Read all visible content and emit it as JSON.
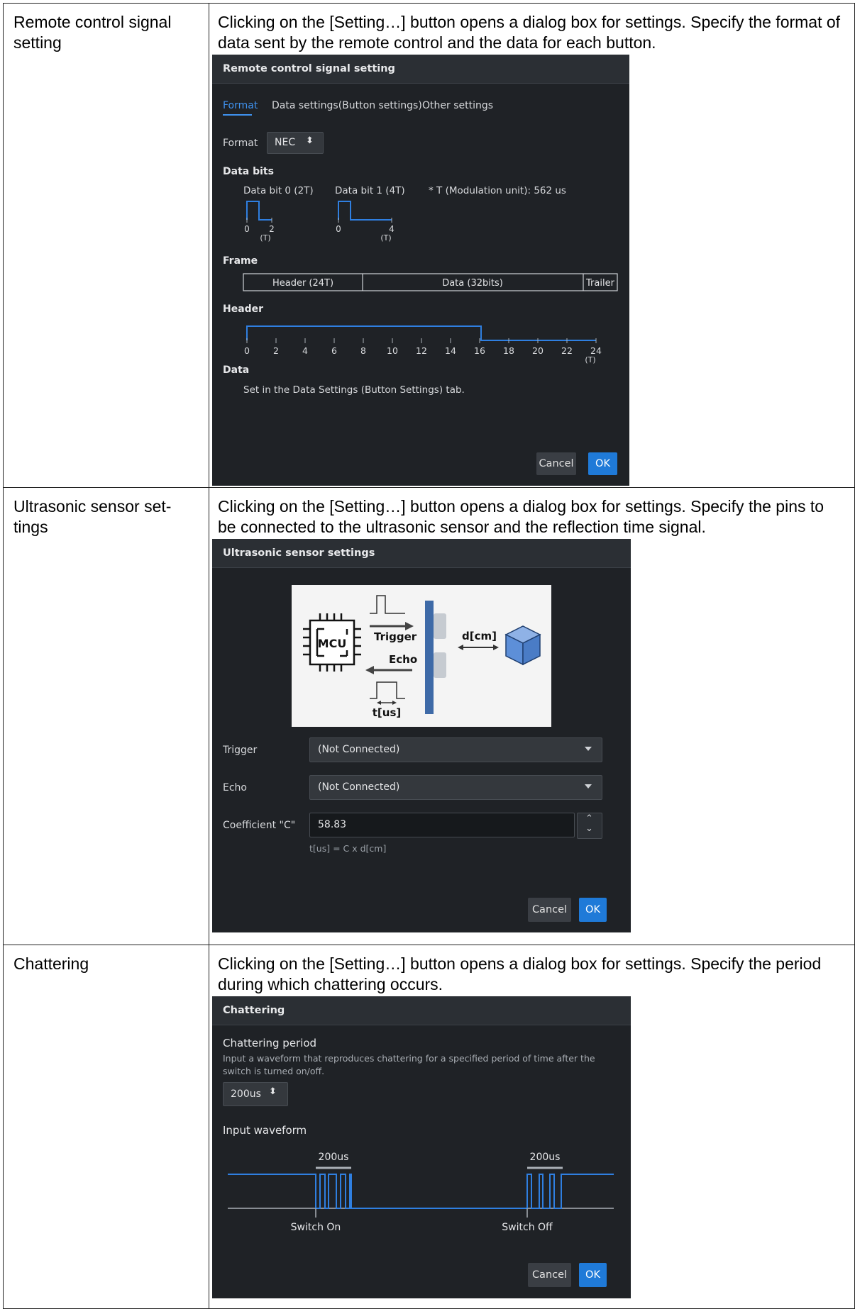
{
  "rows": [
    {
      "label": "Remote control signal setting",
      "desc": "Clicking on the [Setting…] button opens a dialog box for settings. Specify the format of data sent by the remote control and the data for each button."
    },
    {
      "label": "Ultrasonic sensor set-tings",
      "desc": "Clicking on the [Setting…] button opens a dialog box for settings. Specify the pins to be connected to the ultrasonic sensor and the reflection time signal."
    },
    {
      "label": "Chattering",
      "desc": "Clicking on the [Setting…] button opens a dialog box for settings. Specify the period during which chattering occurs."
    }
  ],
  "remote_dialog": {
    "title": "Remote control signal setting",
    "tabs": [
      "Format",
      "Data settings(Button settings)",
      "Other settings"
    ],
    "format_label": "Format",
    "format_value": "NEC",
    "data_bits_heading": "Data bits",
    "bit0_label": "Data bit 0 (2T)",
    "bit1_label": "Data bit 1 (4T)",
    "modulation_note": "* T (Modulation unit): 562 us",
    "bit0_ticks": [
      "0",
      "2",
      "(T)"
    ],
    "bit1_ticks": [
      "0",
      "4",
      "(T)"
    ],
    "frame_heading": "Frame",
    "frame_cells": [
      "Header (24T)",
      "Data (32bits)",
      "Trailer"
    ],
    "header_heading": "Header",
    "header_ticks": [
      "0",
      "2",
      "4",
      "6",
      "8",
      "10",
      "12",
      "14",
      "16",
      "18",
      "20",
      "22",
      "24"
    ],
    "header_unit": "(T)",
    "data_heading": "Data",
    "data_note": "Set in the Data Settings (Button Settings) tab.",
    "cancel": "Cancel",
    "ok": "OK"
  },
  "ultrasonic_dialog": {
    "title": "Ultrasonic sensor settings",
    "diagram": {
      "mcu": "MCU",
      "trigger": "Trigger",
      "echo": "Echo",
      "distance": "d[cm]",
      "time": "t[us]"
    },
    "trigger_label": "Trigger",
    "trigger_value": "(Not Connected)",
    "echo_label": "Echo",
    "echo_value": "(Not Connected)",
    "coef_label": "Coefficient \"C\"",
    "coef_value": "58.83",
    "formula": "t[us] = C x d[cm]",
    "cancel": "Cancel",
    "ok": "OK"
  },
  "chattering_dialog": {
    "title": "Chattering",
    "period_heading": "Chattering period",
    "period_note_1": "Input a waveform that reproduces chattering for a specified period of time after the",
    "period_note_2": "switch is turned on/off.",
    "period_value": "200us",
    "waveform_heading": "Input waveform",
    "dur_left": "200us",
    "dur_right": "200us",
    "switch_on": "Switch On",
    "switch_off": "Switch Off",
    "cancel": "Cancel",
    "ok": "OK"
  },
  "colors": {
    "dialog_bg": "#1f2226",
    "signal_blue": "#2f7fe0",
    "ok_blue": "#1f7ad8"
  }
}
